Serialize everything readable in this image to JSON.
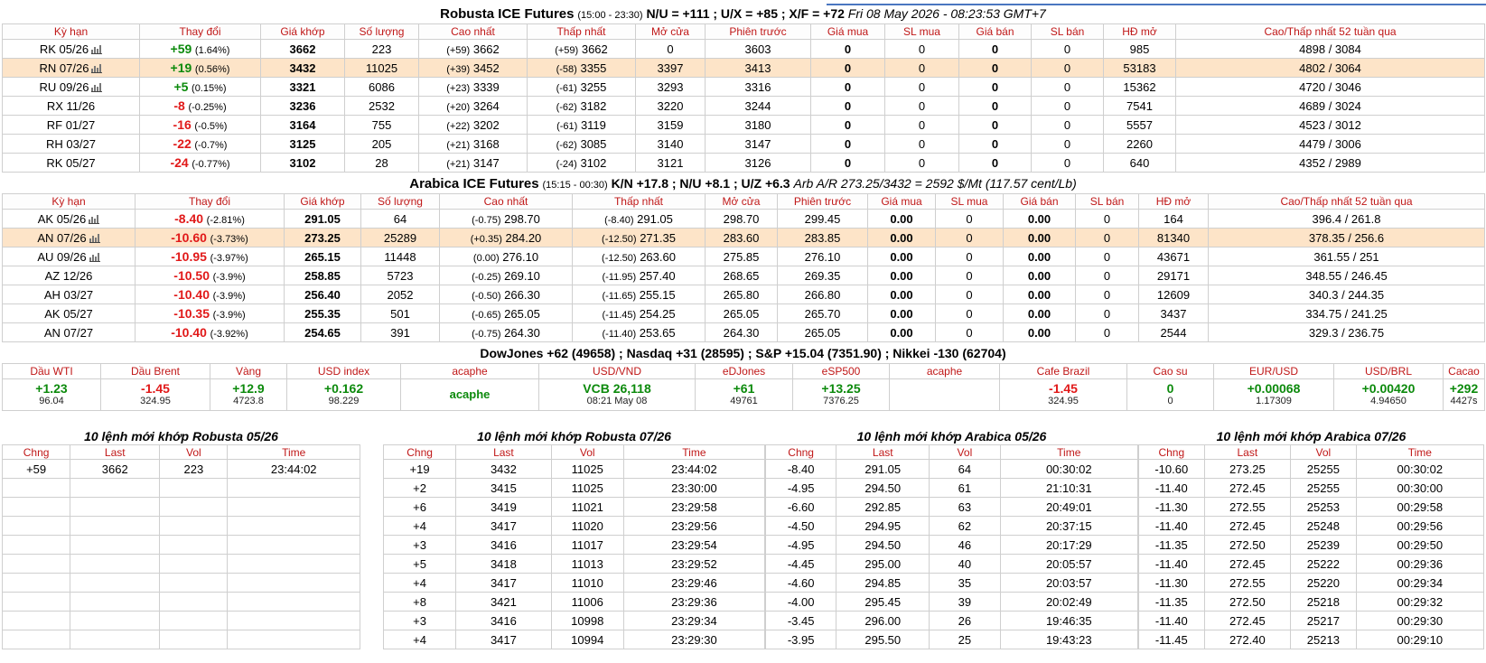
{
  "robusta": {
    "name": "Robusta ICE Futures",
    "hours": "(15:00 - 23:30)",
    "spreads": "N/U = +111 ; U/X = +85 ; X/F = +72",
    "date": "Fri 08 May 2026 - 08:23:53 GMT+7",
    "headers": [
      "Kỳ hạn",
      "Thay đổi",
      "Giá khớp",
      "Số lượng",
      "Cao nhất",
      "Thấp nhất",
      "Mở cửa",
      "Phiên trước",
      "Giá mua",
      "SL mua",
      "Giá bán",
      "SL bán",
      "HĐ mở",
      "Cao/Thấp nhất 52 tuần qua"
    ],
    "rows": [
      {
        "term": "RK 05/26",
        "chart_icon": "bar-chart-icon",
        "chg": "+59",
        "pct": "(1.64%)",
        "dir": "up",
        "last": "3662",
        "vol": "223",
        "high_chg": "(+59)",
        "high": "3662",
        "low_chg": "(+59)",
        "low": "3662",
        "open": "0",
        "prev": "3603",
        "bid": "0",
        "bid_qty": "0",
        "ask": "0",
        "ask_qty": "0",
        "oi": "985",
        "range52": "4898 / 3084",
        "highlight": false
      },
      {
        "term": "RN 07/26",
        "chart_icon": "bar-chart-icon",
        "chg": "+19",
        "pct": "(0.56%)",
        "dir": "up",
        "last": "3432",
        "vol": "11025",
        "high_chg": "(+39)",
        "high": "3452",
        "low_chg": "(-58)",
        "low": "3355",
        "open": "3397",
        "prev": "3413",
        "bid": "0",
        "bid_qty": "0",
        "ask": "0",
        "ask_qty": "0",
        "oi": "53183",
        "range52": "4802 / 3064",
        "highlight": true
      },
      {
        "term": "RU 09/26",
        "chart_icon": "bar-chart-icon",
        "chg": "+5",
        "pct": "(0.15%)",
        "dir": "up",
        "last": "3321",
        "vol": "6086",
        "high_chg": "(+23)",
        "high": "3339",
        "low_chg": "(-61)",
        "low": "3255",
        "open": "3293",
        "prev": "3316",
        "bid": "0",
        "bid_qty": "0",
        "ask": "0",
        "ask_qty": "0",
        "oi": "15362",
        "range52": "4720 / 3046",
        "highlight": false
      },
      {
        "term": "RX 11/26",
        "chart_icon": "",
        "chg": "-8",
        "pct": "(-0.25%)",
        "dir": "dn",
        "last": "3236",
        "vol": "2532",
        "high_chg": "(+20)",
        "high": "3264",
        "low_chg": "(-62)",
        "low": "3182",
        "open": "3220",
        "prev": "3244",
        "bid": "0",
        "bid_qty": "0",
        "ask": "0",
        "ask_qty": "0",
        "oi": "7541",
        "range52": "4689 / 3024",
        "highlight": false
      },
      {
        "term": "RF 01/27",
        "chart_icon": "",
        "chg": "-16",
        "pct": "(-0.5%)",
        "dir": "dn",
        "last": "3164",
        "vol": "755",
        "high_chg": "(+22)",
        "high": "3202",
        "low_chg": "(-61)",
        "low": "3119",
        "open": "3159",
        "prev": "3180",
        "bid": "0",
        "bid_qty": "0",
        "ask": "0",
        "ask_qty": "0",
        "oi": "5557",
        "range52": "4523 / 3012",
        "highlight": false
      },
      {
        "term": "RH 03/27",
        "chart_icon": "",
        "chg": "-22",
        "pct": "(-0.7%)",
        "dir": "dn",
        "last": "3125",
        "vol": "205",
        "high_chg": "(+21)",
        "high": "3168",
        "low_chg": "(-62)",
        "low": "3085",
        "open": "3140",
        "prev": "3147",
        "bid": "0",
        "bid_qty": "0",
        "ask": "0",
        "ask_qty": "0",
        "oi": "2260",
        "range52": "4479 / 3006",
        "highlight": false
      },
      {
        "term": "RK 05/27",
        "chart_icon": "",
        "chg": "-24",
        "pct": "(-0.77%)",
        "dir": "dn",
        "last": "3102",
        "vol": "28",
        "high_chg": "(+21)",
        "high": "3147",
        "low_chg": "(-24)",
        "low": "3102",
        "open": "3121",
        "prev": "3126",
        "bid": "0",
        "bid_qty": "0",
        "ask": "0",
        "ask_qty": "0",
        "oi": "640",
        "range52": "4352 / 2989",
        "highlight": false
      }
    ]
  },
  "arabica": {
    "name": "Arabica ICE Futures",
    "hours": "(15:15 - 00:30)",
    "spreads": "K/N +17.8 ; N/U +8.1 ; U/Z +6.3",
    "arb": "Arb A/R 273.25/3432 = 2592 $/Mt (117.57 cent/Lb)",
    "headers": [
      "Kỳ hạn",
      "Thay đổi",
      "Giá khớp",
      "Số lượng",
      "Cao nhất",
      "Thấp nhất",
      "Mở cửa",
      "Phiên trước",
      "Giá mua",
      "SL mua",
      "Giá bán",
      "SL bán",
      "HĐ mở",
      "Cao/Thấp nhất 52 tuần qua"
    ],
    "rows": [
      {
        "term": "AK 05/26",
        "chart_icon": "bar-chart-icon",
        "chg": "-8.40",
        "pct": "(-2.81%)",
        "dir": "dn",
        "last": "291.05",
        "vol": "64",
        "high_chg": "(-0.75)",
        "high": "298.70",
        "low_chg": "(-8.40)",
        "low": "291.05",
        "open": "298.70",
        "prev": "299.45",
        "bid": "0.00",
        "bid_qty": "0",
        "ask": "0.00",
        "ask_qty": "0",
        "oi": "164",
        "range52": "396.4 / 261.8",
        "highlight": false
      },
      {
        "term": "AN 07/26",
        "chart_icon": "bar-chart-icon",
        "chg": "-10.60",
        "pct": "(-3.73%)",
        "dir": "dn",
        "last": "273.25",
        "vol": "25289",
        "high_chg": "(+0.35)",
        "high": "284.20",
        "low_chg": "(-12.50)",
        "low": "271.35",
        "open": "283.60",
        "prev": "283.85",
        "bid": "0.00",
        "bid_qty": "0",
        "ask": "0.00",
        "ask_qty": "0",
        "oi": "81340",
        "range52": "378.35 / 256.6",
        "highlight": true
      },
      {
        "term": "AU 09/26",
        "chart_icon": "bar-chart-icon",
        "chg": "-10.95",
        "pct": "(-3.97%)",
        "dir": "dn",
        "last": "265.15",
        "vol": "11448",
        "high_chg": "(0.00)",
        "high": "276.10",
        "low_chg": "(-12.50)",
        "low": "263.60",
        "open": "275.85",
        "prev": "276.10",
        "bid": "0.00",
        "bid_qty": "0",
        "ask": "0.00",
        "ask_qty": "0",
        "oi": "43671",
        "range52": "361.55 / 251",
        "highlight": false
      },
      {
        "term": "AZ 12/26",
        "chart_icon": "",
        "chg": "-10.50",
        "pct": "(-3.9%)",
        "dir": "dn",
        "last": "258.85",
        "vol": "5723",
        "high_chg": "(-0.25)",
        "high": "269.10",
        "low_chg": "(-11.95)",
        "low": "257.40",
        "open": "268.65",
        "prev": "269.35",
        "bid": "0.00",
        "bid_qty": "0",
        "ask": "0.00",
        "ask_qty": "0",
        "oi": "29171",
        "range52": "348.55 / 246.45",
        "highlight": false
      },
      {
        "term": "AH 03/27",
        "chart_icon": "",
        "chg": "-10.40",
        "pct": "(-3.9%)",
        "dir": "dn",
        "last": "256.40",
        "vol": "2052",
        "high_chg": "(-0.50)",
        "high": "266.30",
        "low_chg": "(-11.65)",
        "low": "255.15",
        "open": "265.80",
        "prev": "266.80",
        "bid": "0.00",
        "bid_qty": "0",
        "ask": "0.00",
        "ask_qty": "0",
        "oi": "12609",
        "range52": "340.3 / 244.35",
        "highlight": false
      },
      {
        "term": "AK 05/27",
        "chart_icon": "",
        "chg": "-10.35",
        "pct": "(-3.9%)",
        "dir": "dn",
        "last": "255.35",
        "vol": "501",
        "high_chg": "(-0.65)",
        "high": "265.05",
        "low_chg": "(-11.45)",
        "low": "254.25",
        "open": "265.05",
        "prev": "265.70",
        "bid": "0.00",
        "bid_qty": "0",
        "ask": "0.00",
        "ask_qty": "0",
        "oi": "3437",
        "range52": "334.75 / 241.25",
        "highlight": false
      },
      {
        "term": "AN 07/27",
        "chart_icon": "",
        "chg": "-10.40",
        "pct": "(-3.92%)",
        "dir": "dn",
        "last": "254.65",
        "vol": "391",
        "high_chg": "(-0.75)",
        "high": "264.30",
        "low_chg": "(-11.40)",
        "low": "253.65",
        "open": "264.30",
        "prev": "265.05",
        "bid": "0.00",
        "bid_qty": "0",
        "ask": "0.00",
        "ask_qty": "0",
        "oi": "2544",
        "range52": "329.3 / 236.75",
        "highlight": false
      }
    ]
  },
  "indices_line": "DowJones +62 (49658) ; Nasdaq +31 (28595) ; S&P +15.04 (7351.90) ; Nikkei -130 (62704)",
  "markets": [
    {
      "label": "Dầu WTI",
      "v1": "+1.23",
      "v2": "96.04",
      "dir": "up"
    },
    {
      "label": "Dầu Brent",
      "v1": "-1.45",
      "v2": "324.95",
      "dir": "dn"
    },
    {
      "label": "Vàng",
      "v1": "+12.9",
      "v2": "4723.8",
      "dir": "up"
    },
    {
      "label": "USD index",
      "v1": "+0.162",
      "v2": "98.229",
      "dir": "up"
    },
    {
      "label": "acaphe",
      "v1": "acaphe",
      "v2": "",
      "dir": "up"
    },
    {
      "label": "USD/VND",
      "v1": "VCB 26,118",
      "v2": "08:21 May 08",
      "dir": "up"
    },
    {
      "label": "eDJones",
      "v1": "+61",
      "v2": "49761",
      "dir": "up"
    },
    {
      "label": "eSP500",
      "v1": "+13.25",
      "v2": "7376.25",
      "dir": "up"
    },
    {
      "label": "acaphe",
      "v1": "",
      "v2": "",
      "dir": "up"
    },
    {
      "label": "Cafe Brazil",
      "v1": "-1.45",
      "v2": "324.95",
      "dir": "dn"
    },
    {
      "label": "Cao su",
      "v1": "0",
      "v2": "0",
      "dir": "up"
    },
    {
      "label": "EUR/USD",
      "v1": "+0.00068",
      "v2": "1.17309",
      "dir": "up"
    },
    {
      "label": "USD/BRL",
      "v1": "+0.00420",
      "v2": "4.94650",
      "dir": "up"
    },
    {
      "label": "Cacao",
      "v1": "+292",
      "v2": "4427s",
      "dir": "up"
    }
  ],
  "trades": [
    {
      "title": "10 lệnh mới khớp Robusta 05/26",
      "headers": [
        "Chng",
        "Last",
        "Vol",
        "Time"
      ],
      "rows": [
        [
          "+59",
          "3662",
          "223",
          "23:44:02"
        ],
        [
          "",
          "",
          "",
          ""
        ],
        [
          "",
          "",
          "",
          ""
        ],
        [
          "",
          "",
          "",
          ""
        ],
        [
          "",
          "",
          "",
          ""
        ],
        [
          "",
          "",
          "",
          ""
        ],
        [
          "",
          "",
          "",
          ""
        ],
        [
          "",
          "",
          "",
          ""
        ],
        [
          "",
          "",
          "",
          ""
        ],
        [
          "",
          "",
          "",
          ""
        ]
      ]
    },
    {
      "title": "10 lệnh mới khớp Robusta 07/26",
      "headers": [
        "Chng",
        "Last",
        "Vol",
        "Time"
      ],
      "rows": [
        [
          "+19",
          "3432",
          "11025",
          "23:44:02"
        ],
        [
          "+2",
          "3415",
          "11025",
          "23:30:00"
        ],
        [
          "+6",
          "3419",
          "11021",
          "23:29:58"
        ],
        [
          "+4",
          "3417",
          "11020",
          "23:29:56"
        ],
        [
          "+3",
          "3416",
          "11017",
          "23:29:54"
        ],
        [
          "+5",
          "3418",
          "11013",
          "23:29:52"
        ],
        [
          "+4",
          "3417",
          "11010",
          "23:29:46"
        ],
        [
          "+8",
          "3421",
          "11006",
          "23:29:36"
        ],
        [
          "+3",
          "3416",
          "10998",
          "23:29:34"
        ],
        [
          "+4",
          "3417",
          "10994",
          "23:29:30"
        ]
      ]
    },
    {
      "title": "10 lệnh mới khớp Arabica 05/26",
      "headers": [
        "Chng",
        "Last",
        "Vol",
        "Time"
      ],
      "rows": [
        [
          "-8.40",
          "291.05",
          "64",
          "00:30:02"
        ],
        [
          "-4.95",
          "294.50",
          "61",
          "21:10:31"
        ],
        [
          "-6.60",
          "292.85",
          "63",
          "20:49:01"
        ],
        [
          "-4.50",
          "294.95",
          "62",
          "20:37:15"
        ],
        [
          "-4.95",
          "294.50",
          "46",
          "20:17:29"
        ],
        [
          "-4.45",
          "295.00",
          "40",
          "20:05:57"
        ],
        [
          "-4.60",
          "294.85",
          "35",
          "20:03:57"
        ],
        [
          "-4.00",
          "295.45",
          "39",
          "20:02:49"
        ],
        [
          "-3.45",
          "296.00",
          "26",
          "19:46:35"
        ],
        [
          "-3.95",
          "295.50",
          "25",
          "19:43:23"
        ]
      ]
    },
    {
      "title": "10 lệnh mới khớp Arabica 07/26",
      "headers": [
        "Chng",
        "Last",
        "Vol",
        "Time"
      ],
      "rows": [
        [
          "-10.60",
          "273.25",
          "25255",
          "00:30:02"
        ],
        [
          "-11.40",
          "272.45",
          "25255",
          "00:30:00"
        ],
        [
          "-11.30",
          "272.55",
          "25253",
          "00:29:58"
        ],
        [
          "-11.40",
          "272.45",
          "25248",
          "00:29:56"
        ],
        [
          "-11.35",
          "272.50",
          "25239",
          "00:29:50"
        ],
        [
          "-11.40",
          "272.45",
          "25222",
          "00:29:36"
        ],
        [
          "-11.30",
          "272.55",
          "25220",
          "00:29:34"
        ],
        [
          "-11.35",
          "272.50",
          "25218",
          "00:29:32"
        ],
        [
          "-11.40",
          "272.45",
          "25217",
          "00:29:30"
        ],
        [
          "-11.45",
          "272.40",
          "25213",
          "00:29:10"
        ]
      ]
    }
  ],
  "colors": {
    "up": "#0c8a0c",
    "down": "#e11919",
    "header_text": "#c01818",
    "highlight_row": "#fde4c8"
  }
}
